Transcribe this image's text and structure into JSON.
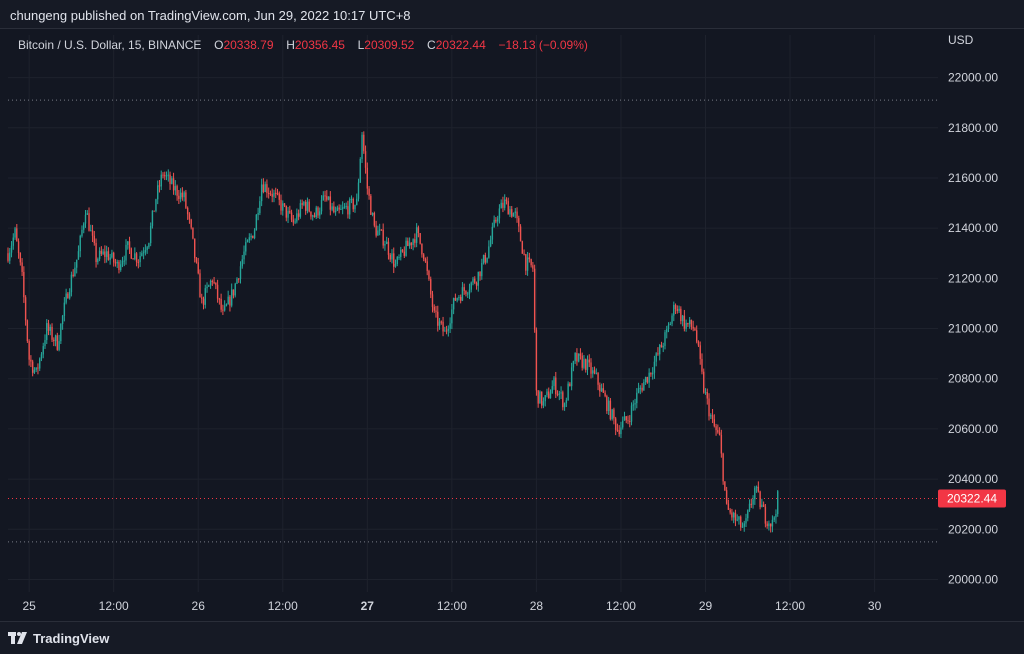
{
  "header": {
    "published": "chungeng published on TradingView.com, Jun 29, 2022 10:17 UTC+8"
  },
  "legend": {
    "symbol": "Bitcoin / U.S. Dollar, 15, BINANCE",
    "o_label": "O",
    "o_value": "20338.79",
    "h_label": "H",
    "h_value": "20356.45",
    "l_label": "L",
    "l_value": "20309.52",
    "c_label": "C",
    "c_value": "20322.44",
    "change": "−18.13 (−0.09%)"
  },
  "axis": {
    "currency": "USD"
  },
  "footer": {
    "brand": "TradingView"
  },
  "colors": {
    "background": "#131722",
    "up": "#26a69a",
    "down": "#ef5350",
    "grid": "#1e222d",
    "price_tag": "#f23645",
    "text": "#d1d4dc"
  },
  "chart_data": {
    "type": "candlestick",
    "title": "Bitcoin / U.S. Dollar, 15, BINANCE",
    "y_unit": "USD",
    "ylim": [
      19950,
      22090
    ],
    "y_ticks": [
      20000,
      20200,
      20400,
      20600,
      20800,
      21000,
      21200,
      21400,
      21600,
      21800,
      22000
    ],
    "y_tick_labels": [
      "20000.00",
      "20200.00",
      "20400.00",
      "20600.00",
      "20800.00",
      "21000.00",
      "21200.00",
      "21400.00",
      "21600.00",
      "21800.00",
      "22000.00"
    ],
    "x_range": [
      "2022-06-24 21:00",
      "2022-06-30 09:00"
    ],
    "x_ticks": [
      "2022-06-25 00:00",
      "2022-06-25 12:00",
      "2022-06-26 00:00",
      "2022-06-26 12:00",
      "2022-06-27 00:00",
      "2022-06-27 12:00",
      "2022-06-28 00:00",
      "2022-06-28 12:00",
      "2022-06-29 00:00",
      "2022-06-29 12:00",
      "2022-06-30 00:00"
    ],
    "x_tick_labels": [
      "25",
      "12:00",
      "26",
      "12:00",
      "27",
      "12:00",
      "28",
      "12:00",
      "29",
      "12:00",
      "30"
    ],
    "x_tick_bold": [
      false,
      false,
      false,
      false,
      true,
      false,
      false,
      false,
      false,
      false,
      false
    ],
    "last_price": 20322.44,
    "last_price_label": "20322.44",
    "visible_high_line": 21910,
    "visible_low_line": 20150,
    "grid": true,
    "candle_interval_minutes": 15,
    "price_path": [
      [
        "2022-06-24 21:00",
        21300
      ],
      [
        "2022-06-24 22:00",
        21380
      ],
      [
        "2022-06-24 23:00",
        21200
      ],
      [
        "2022-06-25 00:00",
        20880
      ],
      [
        "2022-06-25 01:00",
        20820
      ],
      [
        "2022-06-25 02:30",
        21000
      ],
      [
        "2022-06-25 04:00",
        20940
      ],
      [
        "2022-06-25 05:30",
        21150
      ],
      [
        "2022-06-25 07:00",
        21300
      ],
      [
        "2022-06-25 08:00",
        21480
      ],
      [
        "2022-06-25 09:30",
        21280
      ],
      [
        "2022-06-25 11:00",
        21300
      ],
      [
        "2022-06-25 12:30",
        21250
      ],
      [
        "2022-06-25 14:00",
        21320
      ],
      [
        "2022-06-25 15:30",
        21280
      ],
      [
        "2022-06-25 17:00",
        21360
      ],
      [
        "2022-06-25 18:00",
        21520
      ],
      [
        "2022-06-25 19:00",
        21620
      ],
      [
        "2022-06-25 20:30",
        21560
      ],
      [
        "2022-06-25 22:00",
        21520
      ],
      [
        "2022-06-25 23:00",
        21380
      ],
      [
        "2022-06-26 00:30",
        21100
      ],
      [
        "2022-06-26 02:00",
        21200
      ],
      [
        "2022-06-26 03:30",
        21050
      ],
      [
        "2022-06-26 05:00",
        21150
      ],
      [
        "2022-06-26 06:30",
        21300
      ],
      [
        "2022-06-26 08:00",
        21400
      ],
      [
        "2022-06-26 09:00",
        21580
      ],
      [
        "2022-06-26 10:30",
        21540
      ],
      [
        "2022-06-26 12:00",
        21480
      ],
      [
        "2022-06-26 13:30",
        21420
      ],
      [
        "2022-06-26 15:00",
        21500
      ],
      [
        "2022-06-26 16:30",
        21450
      ],
      [
        "2022-06-26 18:00",
        21520
      ],
      [
        "2022-06-26 19:30",
        21450
      ],
      [
        "2022-06-26 21:00",
        21480
      ],
      [
        "2022-06-26 22:30",
        21500
      ],
      [
        "2022-06-26 23:15",
        21780
      ],
      [
        "2022-06-27 00:00",
        21560
      ],
      [
        "2022-06-27 01:00",
        21400
      ],
      [
        "2022-06-27 02:30",
        21350
      ],
      [
        "2022-06-27 04:00",
        21250
      ],
      [
        "2022-06-27 05:30",
        21320
      ],
      [
        "2022-06-27 07:00",
        21380
      ],
      [
        "2022-06-27 08:00",
        21300
      ],
      [
        "2022-06-27 09:30",
        21050
      ],
      [
        "2022-06-27 11:00",
        20980
      ],
      [
        "2022-06-27 12:30",
        21120
      ],
      [
        "2022-06-27 14:00",
        21160
      ],
      [
        "2022-06-27 15:30",
        21200
      ],
      [
        "2022-06-27 17:00",
        21300
      ],
      [
        "2022-06-27 18:30",
        21460
      ],
      [
        "2022-06-27 19:30",
        21500
      ],
      [
        "2022-06-27 21:00",
        21450
      ],
      [
        "2022-06-27 22:30",
        21260
      ],
      [
        "2022-06-27 23:30",
        21240
      ],
      [
        "2022-06-28 00:00",
        20740
      ],
      [
        "2022-06-28 01:00",
        20700
      ],
      [
        "2022-06-28 02:30",
        20780
      ],
      [
        "2022-06-28 04:00",
        20700
      ],
      [
        "2022-06-28 05:30",
        20880
      ],
      [
        "2022-06-28 07:00",
        20860
      ],
      [
        "2022-06-28 08:30",
        20800
      ],
      [
        "2022-06-28 10:00",
        20700
      ],
      [
        "2022-06-28 11:30",
        20600
      ],
      [
        "2022-06-28 13:00",
        20640
      ],
      [
        "2022-06-28 14:30",
        20750
      ],
      [
        "2022-06-28 16:00",
        20820
      ],
      [
        "2022-06-28 17:00",
        20880
      ],
      [
        "2022-06-28 18:30",
        20980
      ],
      [
        "2022-06-28 19:45",
        21100
      ],
      [
        "2022-06-28 21:00",
        21020
      ],
      [
        "2022-06-28 22:30",
        21000
      ],
      [
        "2022-06-28 23:45",
        20760
      ],
      [
        "2022-06-29 01:00",
        20620
      ],
      [
        "2022-06-29 02:00",
        20560
      ],
      [
        "2022-06-29 03:00",
        20280
      ],
      [
        "2022-06-29 04:30",
        20230
      ],
      [
        "2022-06-29 05:30",
        20200
      ],
      [
        "2022-06-29 07:00",
        20360
      ],
      [
        "2022-06-29 08:30",
        20250
      ],
      [
        "2022-06-29 09:30",
        20220
      ],
      [
        "2022-06-29 10:15",
        20322
      ]
    ]
  }
}
